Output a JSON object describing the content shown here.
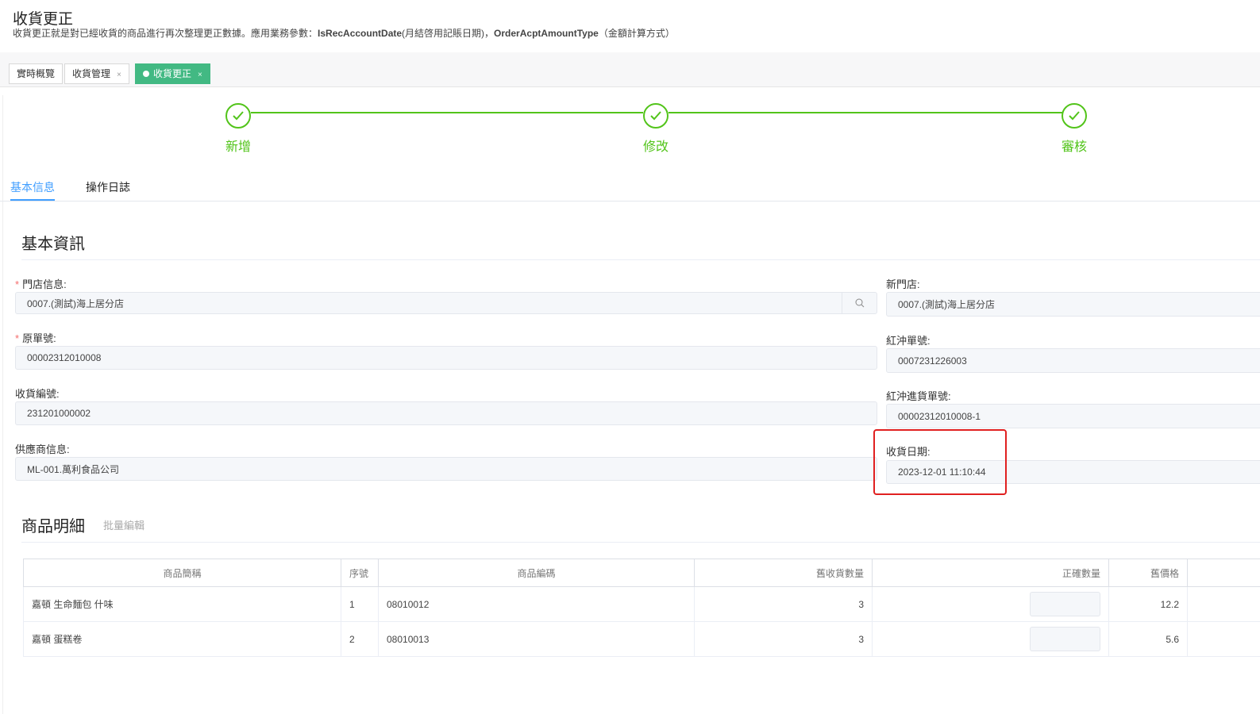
{
  "header": {
    "title": "收貨更正",
    "desc_prefix": "收貨更正就是對已經收貨的商品進行再次整理更正數據。應用業務參數：",
    "param1": "IsRecAccountDate",
    "param1_desc": "(月結啓用記賬日期)，",
    "param2": "OrderAcptAmountType",
    "param2_desc": "（金額計算方式）"
  },
  "tabs": [
    {
      "label": "實時概覽"
    },
    {
      "label": "收貨管理",
      "close": "×"
    },
    {
      "label": "收貨更正",
      "close": "×"
    }
  ],
  "steps": [
    {
      "label": "新增"
    },
    {
      "label": "修改"
    },
    {
      "label": "審核"
    }
  ],
  "inner_tabs": [
    {
      "label": "基本信息"
    },
    {
      "label": "操作日誌"
    }
  ],
  "basic": {
    "title": "基本資訊",
    "store_label": "門店信息:",
    "store_value": "0007.(測試)海上居分店",
    "orig_label": "原單號:",
    "orig_value": "00002312010008",
    "recno_label": "收貨編號:",
    "recno_value": "231201000002",
    "supplier_label": "供應商信息:",
    "supplier_value": "ML-001.萬利食品公司",
    "newstore_label": "新門店:",
    "newstore_value": "0007.(測試)海上居分店",
    "red_label": "紅沖單號:",
    "red_value": "0007231226003",
    "redin_label": "紅沖進貨單號:",
    "redin_value": "00002312010008-1",
    "date_label": "收貨日期:",
    "date_value": "2023-12-01 11:10:44"
  },
  "goods": {
    "title": "商品明細",
    "batch_edit": "批量編輯",
    "columns": [
      "商品簡稱",
      "序號",
      "商品編碼",
      "舊收貨數量",
      "正確數量",
      "舊價格",
      ""
    ],
    "rows": [
      {
        "name": "嘉頓 生命麵包 什味",
        "seq": "1",
        "code": "08010012",
        "old_qty": "3",
        "price": "12.2"
      },
      {
        "name": "嘉頓 蛋糕卷",
        "seq": "2",
        "code": "08010013",
        "old_qty": "3",
        "price": "5.6"
      }
    ]
  },
  "colors": {
    "accent": "#409eff",
    "success": "#52c41a",
    "tab_active": "#42b983",
    "highlight": "#e02020"
  }
}
